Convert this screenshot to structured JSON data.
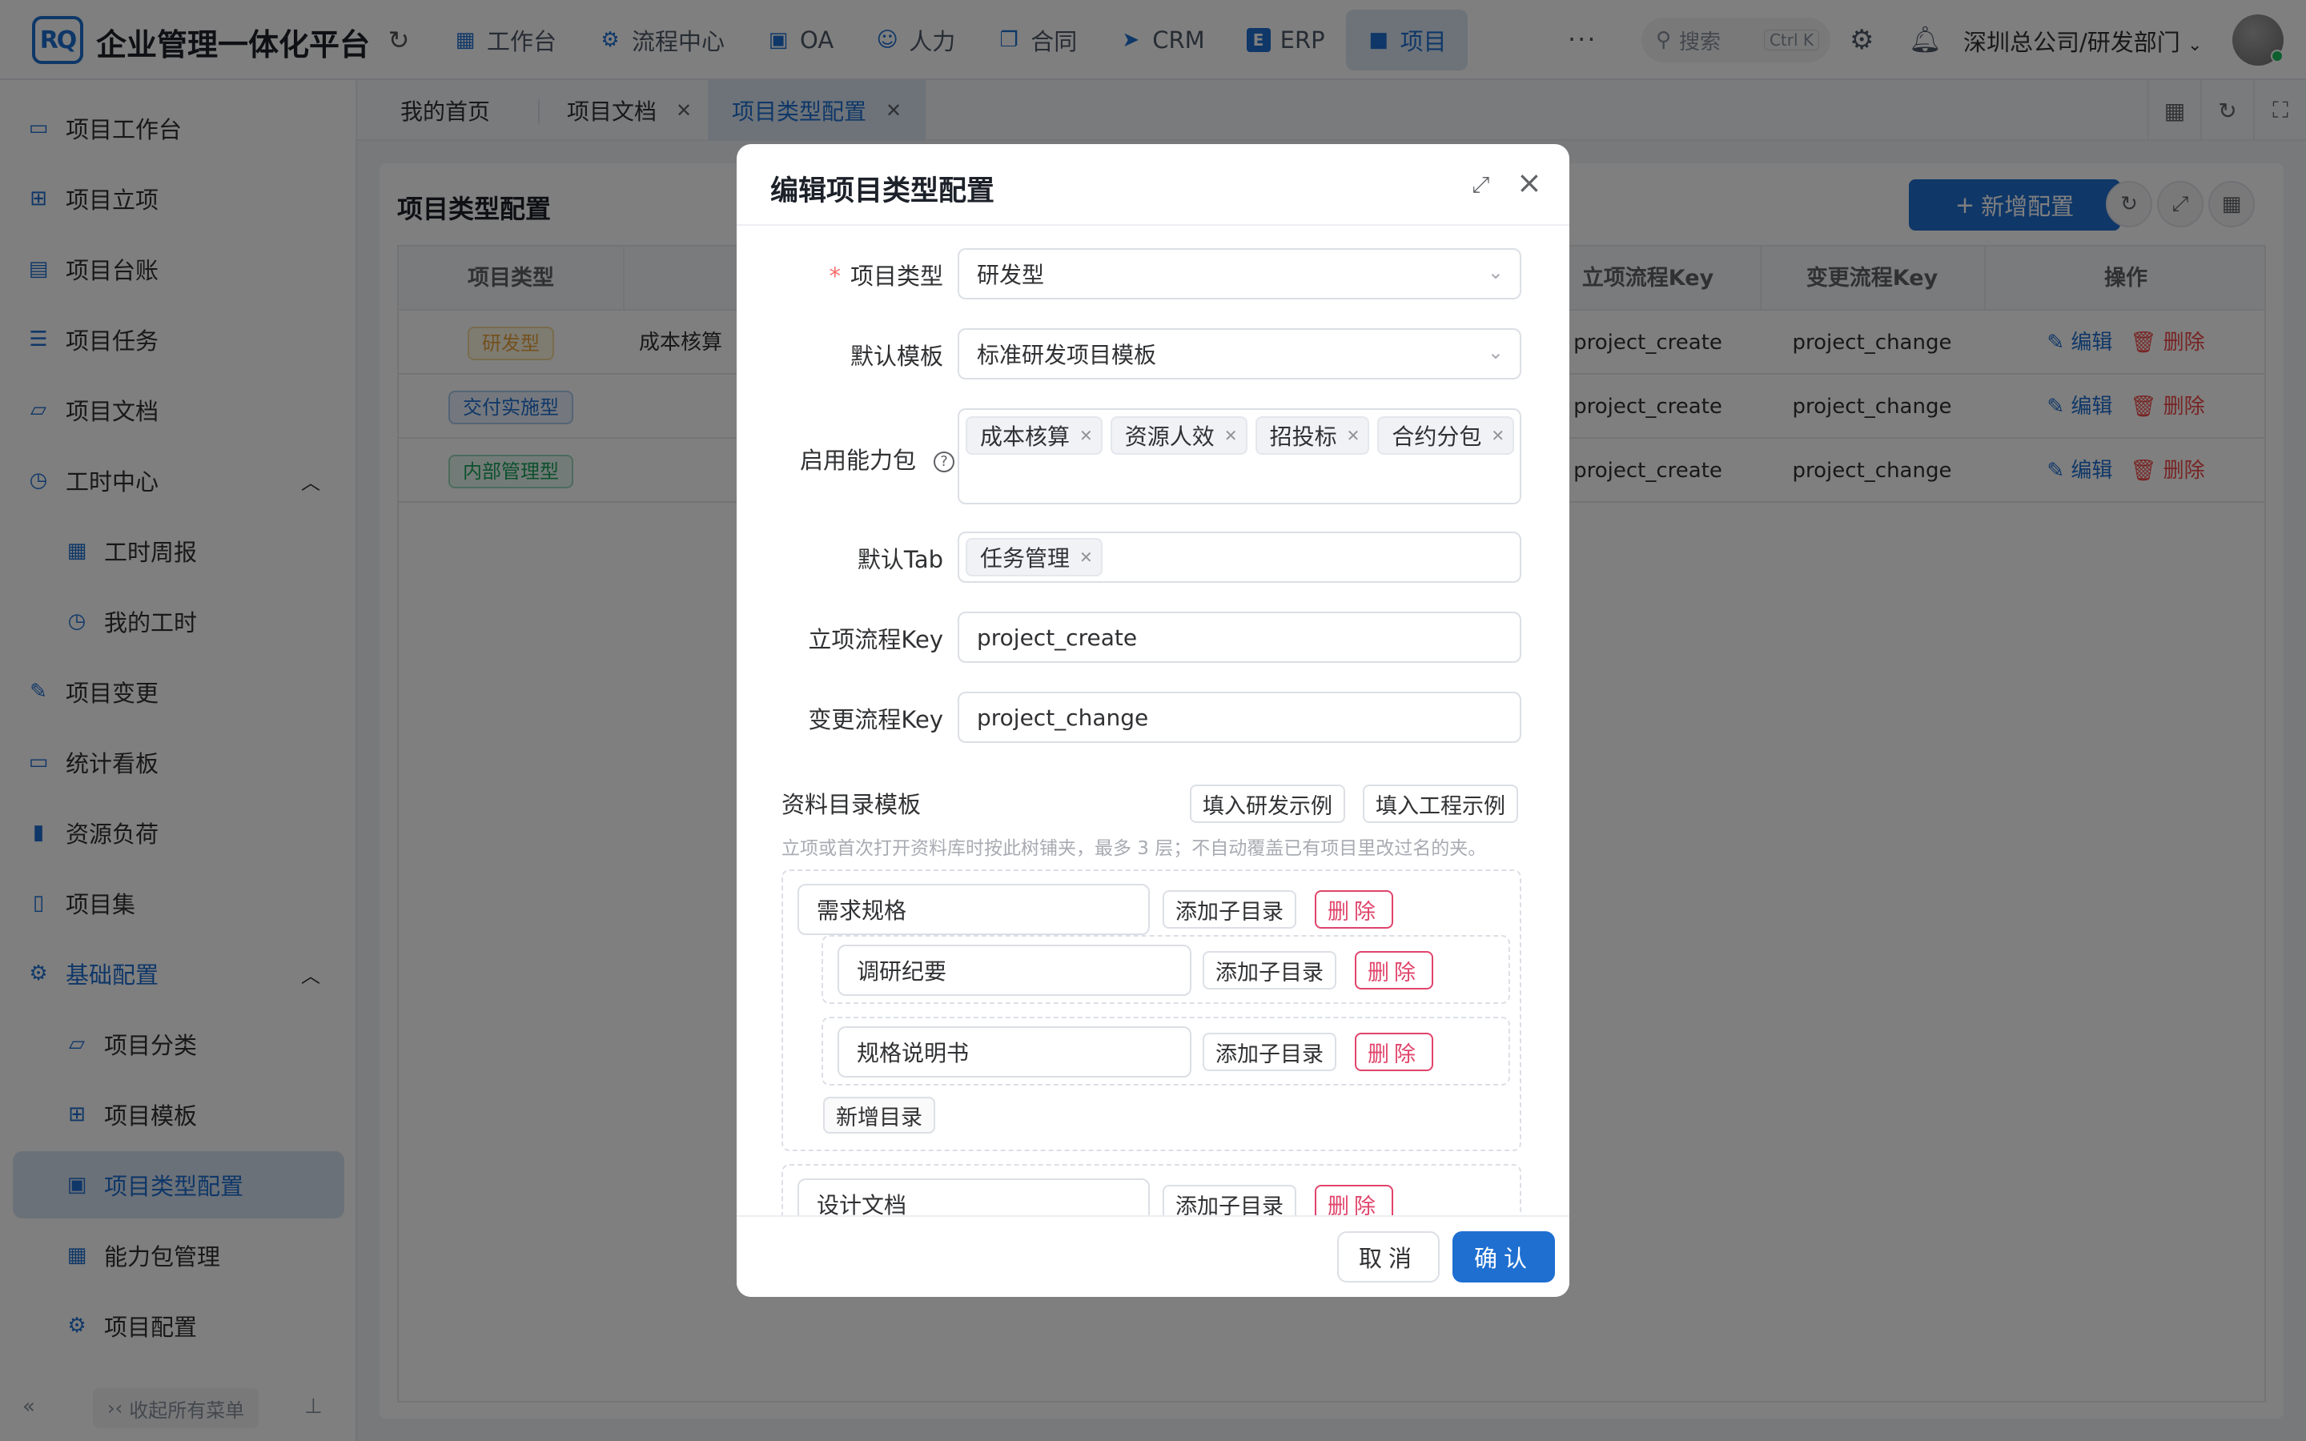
{
  "header": {
    "logo_text": "RQ",
    "app_title": "企业管理一体化平台",
    "nav": [
      {
        "label": "工作台",
        "icon": "dashboard-icon"
      },
      {
        "label": "流程中心",
        "icon": "flow-icon"
      },
      {
        "label": "OA",
        "icon": "oa-icon"
      },
      {
        "label": "人力",
        "icon": "people-icon"
      },
      {
        "label": "合同",
        "icon": "contract-icon"
      },
      {
        "label": "CRM",
        "icon": "crm-icon"
      },
      {
        "label": "ERP",
        "icon": "erp-icon"
      },
      {
        "label": "项目",
        "icon": "briefcase-icon"
      }
    ],
    "active_nav": "项目",
    "search_placeholder": "搜索",
    "search_shortcut": "Ctrl K",
    "org": "深圳总公司/研发部门"
  },
  "sidebar": {
    "items": [
      {
        "label": "项目工作台",
        "icon": "monitor-icon"
      },
      {
        "label": "项目立项",
        "icon": "file-add-icon"
      },
      {
        "label": "项目台账",
        "icon": "ledger-icon"
      },
      {
        "label": "项目任务",
        "icon": "task-list-icon"
      },
      {
        "label": "项目文档",
        "icon": "folder-icon"
      },
      {
        "label": "工时中心",
        "icon": "clock-icon"
      },
      {
        "label": "工时周报",
        "icon": "calendar-icon"
      },
      {
        "label": "我的工时",
        "icon": "clock-icon"
      },
      {
        "label": "项目变更",
        "icon": "edit-icon"
      },
      {
        "label": "统计看板",
        "icon": "board-icon"
      },
      {
        "label": "资源负荷",
        "icon": "bar-chart-icon"
      },
      {
        "label": "项目集",
        "icon": "book-icon"
      },
      {
        "label": "基础配置",
        "icon": "settings-icon"
      },
      {
        "label": "项目分类",
        "icon": "folder-icon"
      },
      {
        "label": "项目模板",
        "icon": "file-add-icon"
      },
      {
        "label": "项目类型配置",
        "icon": "image-config-icon"
      },
      {
        "label": "能力包管理",
        "icon": "grid-icon"
      },
      {
        "label": "项目配置",
        "icon": "gear-icon"
      }
    ],
    "active_item": "项目类型配置",
    "collapse_all": "收起所有菜单"
  },
  "tabs": [
    {
      "label": "我的首页"
    },
    {
      "label": "项目文档"
    },
    {
      "label": "项目类型配置"
    }
  ],
  "page": {
    "title": "项目类型配置",
    "add_button": "新增配置",
    "columns": [
      "项目类型",
      "立项流程Key",
      "变更流程Key",
      "操作"
    ],
    "rows": [
      {
        "type": "研发型",
        "pack": "成本核算",
        "create_key": "project_create",
        "change_key": "project_change",
        "tag_color": "#e6a23c"
      },
      {
        "type": "交付实施型",
        "pack": "",
        "create_key": "project_create",
        "change_key": "project_change",
        "tag_color": "#1f6fd1"
      },
      {
        "type": "内部管理型",
        "pack": "",
        "create_key": "project_create",
        "change_key": "project_change",
        "tag_color": "#18a058"
      }
    ],
    "edit_label": "编辑",
    "delete_label": "删除"
  },
  "dialog": {
    "title": "编辑项目类型配置",
    "labels": {
      "type": "项目类型",
      "template": "默认模板",
      "packs": "启用能力包",
      "default_tab": "默认Tab",
      "create_key": "立项流程Key",
      "change_key": "变更流程Key"
    },
    "values": {
      "type": "研发型",
      "template": "标准研发项目模板",
      "packs": [
        "成本核算",
        "资源人效",
        "招投标",
        "合约分包"
      ],
      "default_tab": [
        "任务管理"
      ],
      "create_key": "project_create",
      "change_key": "project_change"
    },
    "directory": {
      "title": "资料目录模板",
      "fill_rd": "填入研发示例",
      "fill_eng": "填入工程示例",
      "hint": "立项或首次打开资料库时按此树铺夹，最多 3 层；不自动覆盖已有项目里改过名的夹。",
      "add_child": "添加子目录",
      "delete": "删除",
      "add_dir": "新增目录",
      "tree": [
        {
          "name": "需求规格",
          "children": [
            "调研纪要",
            "规格说明书"
          ]
        },
        {
          "name": "设计文档",
          "children": []
        }
      ]
    },
    "cancel": "取消",
    "confirm": "确认"
  }
}
